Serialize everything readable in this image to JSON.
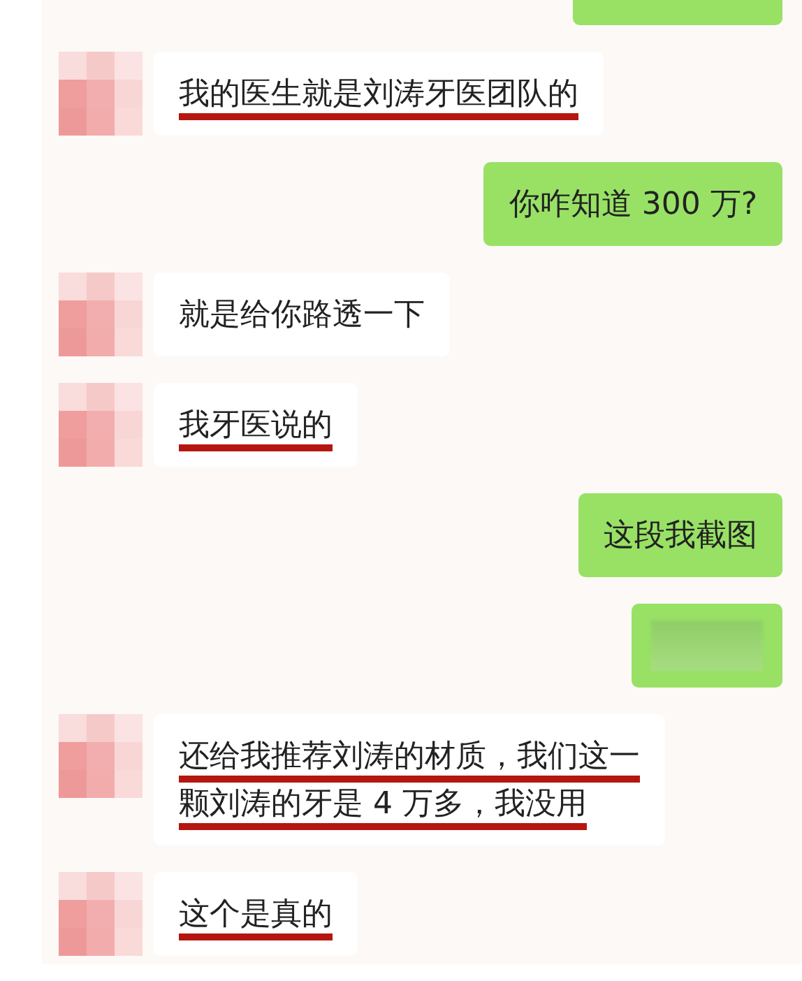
{
  "messages": [
    {
      "kind": "partial"
    },
    {
      "kind": "received",
      "lines": [
        "我的医生就是刘涛牙医团队的"
      ],
      "underlined": true
    },
    {
      "kind": "sent",
      "lines": [
        "你咋知道 300 万?"
      ],
      "underlined": false
    },
    {
      "kind": "received",
      "lines": [
        "就是给你路透一下"
      ],
      "underlined": false
    },
    {
      "kind": "received",
      "lines": [
        "我牙医说的"
      ],
      "underlined": true
    },
    {
      "kind": "sent",
      "lines": [
        "这段我截图"
      ],
      "underlined": false
    },
    {
      "kind": "redacted"
    },
    {
      "kind": "received",
      "lines": [
        "还给我推荐刘涛的材质，我们这一",
        "颗刘涛的牙是 4 万多，我没用"
      ],
      "underlined": true
    },
    {
      "kind": "received",
      "lines": [
        "这个是真的"
      ],
      "underlined": true
    }
  ]
}
